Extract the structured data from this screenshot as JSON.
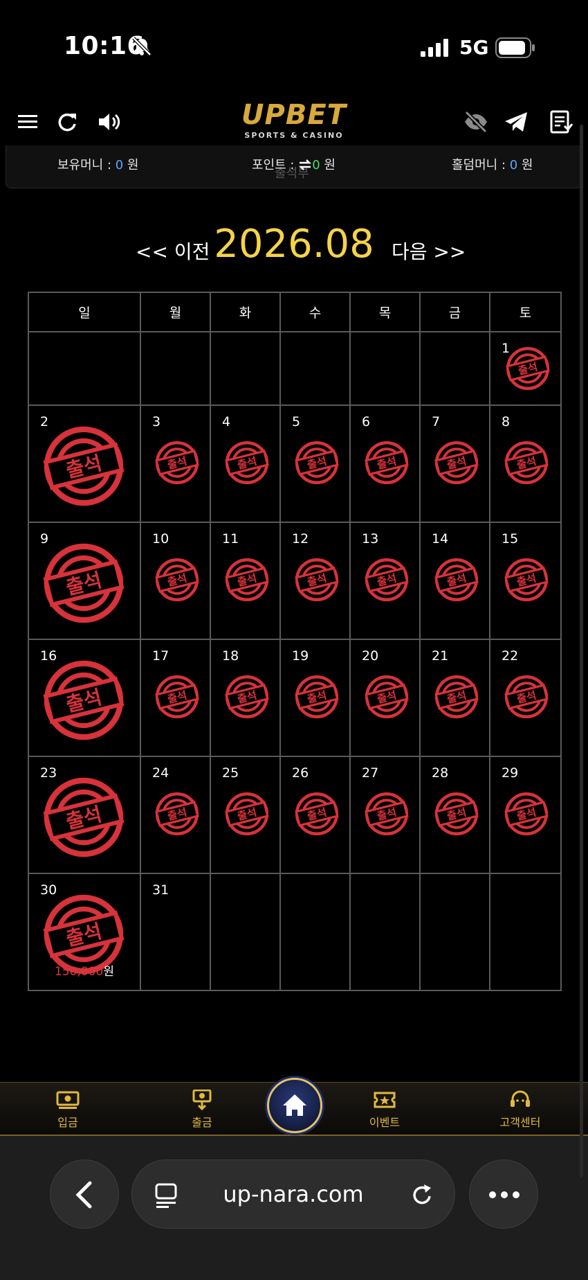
{
  "status_bar": {
    "time": "10:16",
    "network": "5G"
  },
  "header": {
    "logo_main": "UPBET",
    "logo_sub": "SPORTS & CASINO"
  },
  "money_bar": {
    "balance_label": "보유머니 : ",
    "balance_value": "0",
    "balance_unit": " 원",
    "point_label": "포인트 : ",
    "point_value": "0",
    "point_unit": " 원",
    "holdem_label": "홀덤머니 : ",
    "holdem_value": "0",
    "holdem_unit": " 원",
    "ghost_text": "출석부"
  },
  "calendar_nav": {
    "prev_label": "<< 이전",
    "month": "2026.08",
    "next_label": "다음 >>"
  },
  "calendar": {
    "weekdays": [
      "일",
      "월",
      "화",
      "수",
      "목",
      "금",
      "토"
    ],
    "weeks": [
      [
        "",
        "",
        "",
        "",
        "",
        "",
        "1"
      ],
      [
        "2",
        "3",
        "4",
        "5",
        "6",
        "7",
        "8"
      ],
      [
        "9",
        "10",
        "11",
        "12",
        "13",
        "14",
        "15"
      ],
      [
        "16",
        "17",
        "18",
        "19",
        "20",
        "21",
        "22"
      ],
      [
        "23",
        "24",
        "25",
        "26",
        "27",
        "28",
        "29"
      ],
      [
        "30",
        "31",
        "",
        "",
        "",
        "",
        ""
      ]
    ],
    "stamp_text": "출석",
    "stamp_color": "#d8323a",
    "reward_amount": "150,000",
    "reward_unit": "원"
  },
  "bottom_nav": {
    "deposit": "입금",
    "withdraw": "출금",
    "event": "이벤트",
    "support": "고객센터"
  },
  "browser": {
    "url": "up-nara.com"
  }
}
